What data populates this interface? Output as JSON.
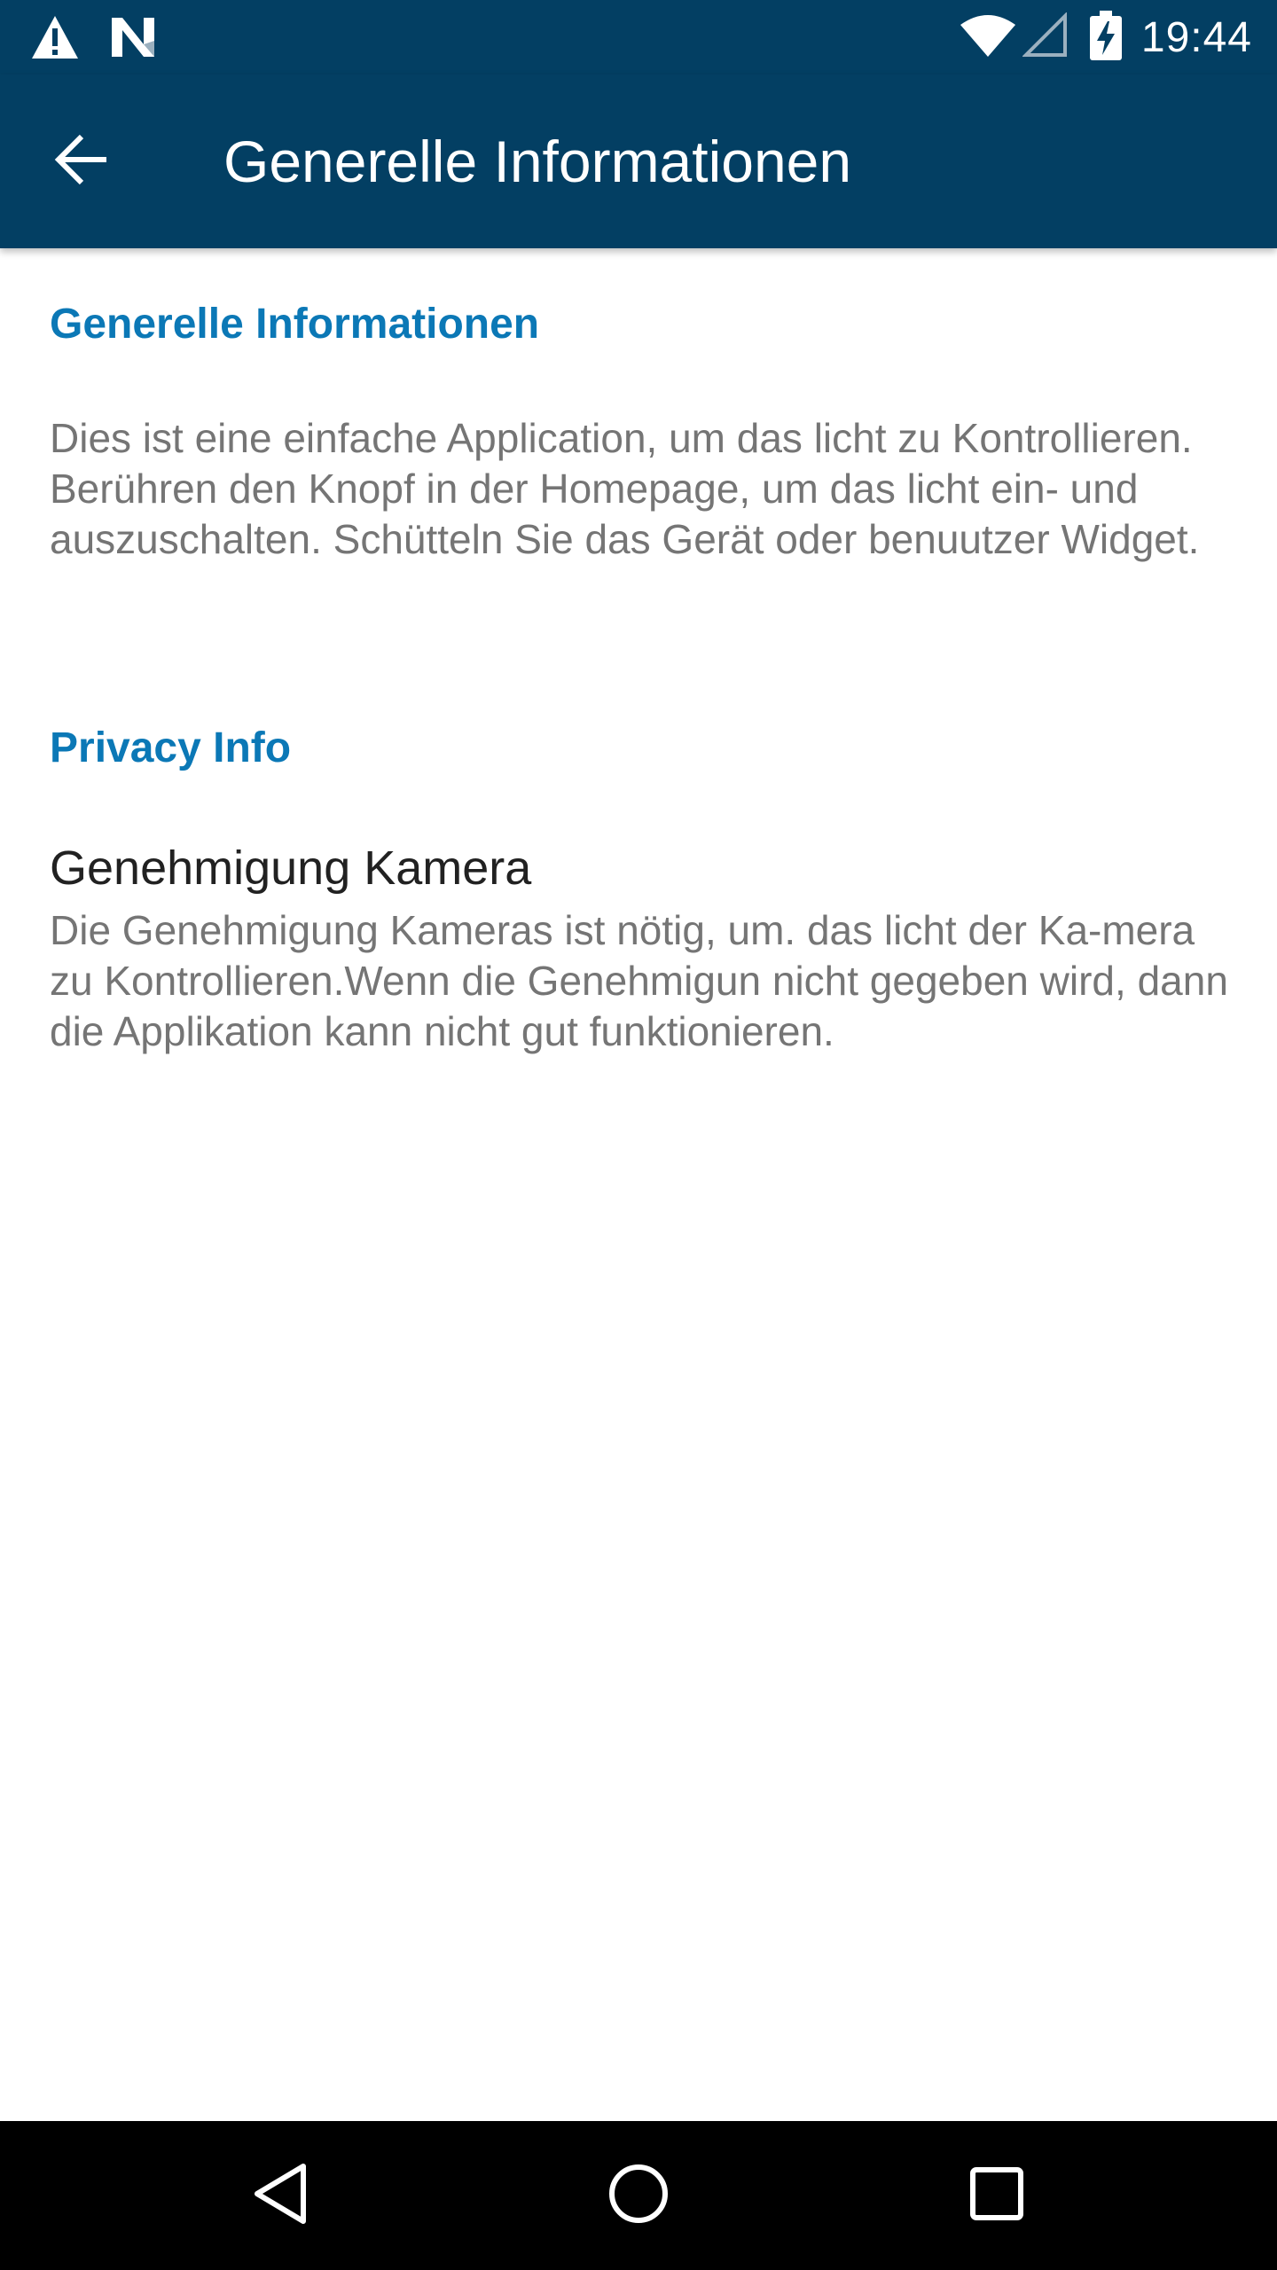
{
  "status_bar": {
    "time": "19:44",
    "icons": [
      "warning-icon",
      "n-notification-icon",
      "wifi-icon",
      "cell-signal-icon",
      "battery-charging-icon"
    ]
  },
  "app_bar": {
    "title": "Generelle Informationen",
    "back_icon": "arrow-back-icon"
  },
  "sections": {
    "general": {
      "header": "Generelle Informationen",
      "text": "Dies ist eine einfache Application, um das licht zu Kontrollieren. Berühren den Knopf in der Homepage, um das licht ein- und auszuschalten. Schütteln Sie das Gerät oder benuutzer Widget."
    },
    "privacy": {
      "header": "Privacy Info",
      "item_title": "Genehmigung Kamera",
      "item_text": "Die Genehmigung Kameras ist nötig, um. das licht der Ka-mera zu Kontrollieren.Wenn die Genehmigun nicht gegeben wird, dann die Applikation kann nicht gut funktionieren."
    }
  },
  "nav_bar": {
    "icons": [
      "nav-back-icon",
      "nav-home-icon",
      "nav-recents-icon"
    ]
  },
  "colors": {
    "primary": "#033f63",
    "accent": "#0b78b6",
    "secondary_text": "#757575",
    "primary_text": "#212121"
  }
}
